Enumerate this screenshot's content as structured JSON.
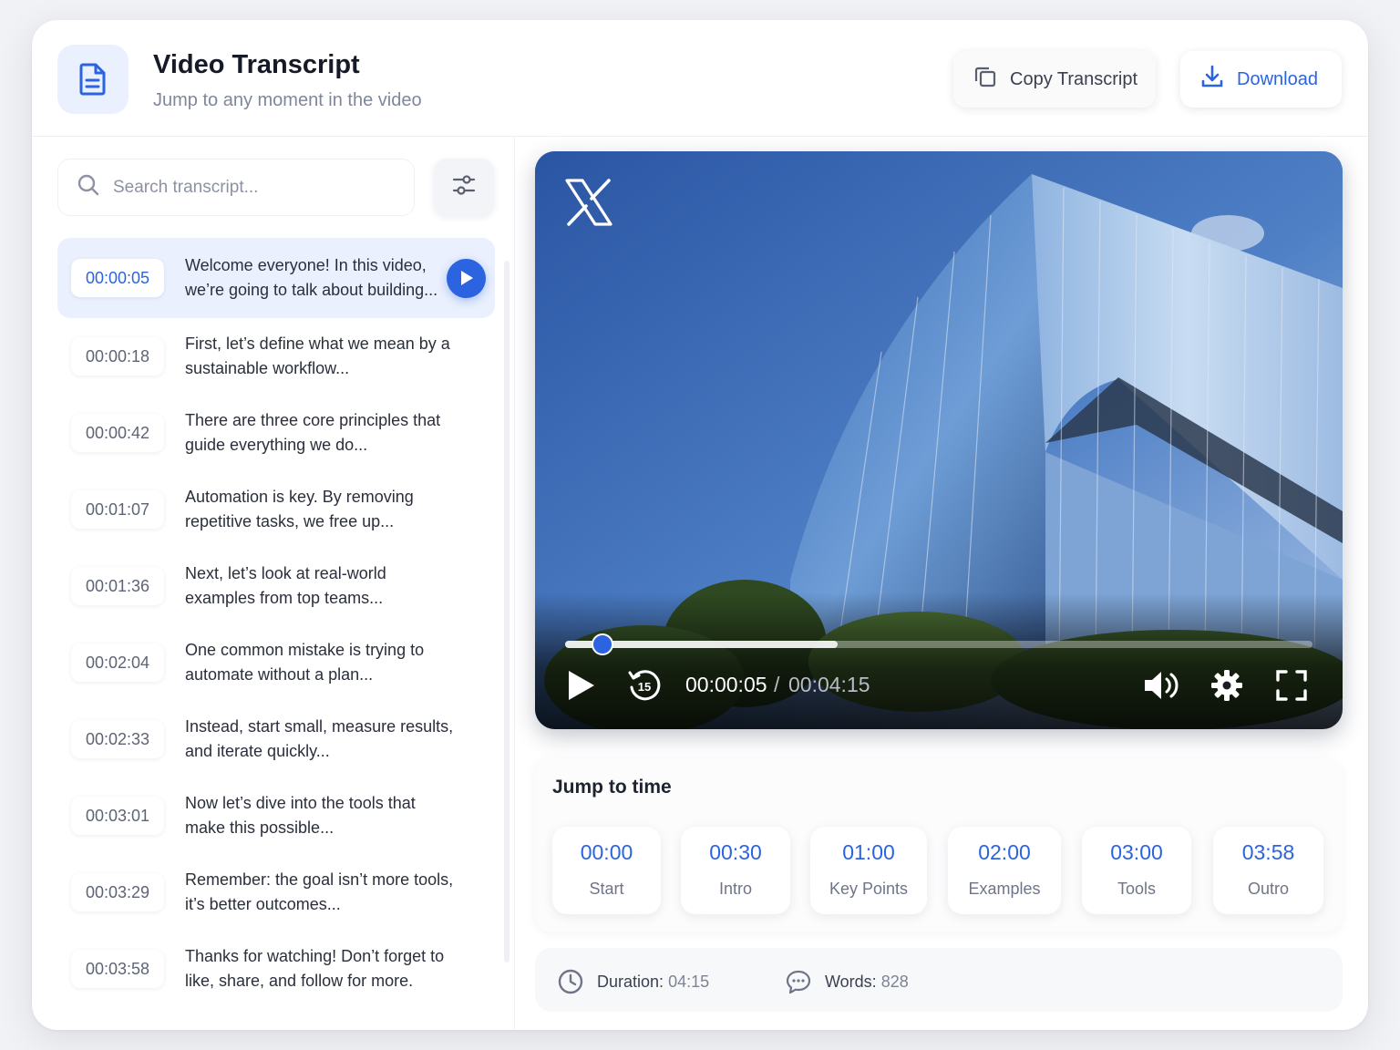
{
  "header": {
    "title": "Video Transcript",
    "subtitle": "Jump to any moment in the video",
    "copy_label": "Copy Transcript",
    "download_label": "Download"
  },
  "search": {
    "placeholder": "Search transcript..."
  },
  "transcript": [
    {
      "time": "00:00:05",
      "text": "Welcome everyone! In this video, we’re going to talk about building...",
      "active": true
    },
    {
      "time": "00:00:18",
      "text": "First, let’s define what we mean by a sustainable workflow..."
    },
    {
      "time": "00:00:42",
      "text": "There are three core principles that guide everything we do..."
    },
    {
      "time": "00:01:07",
      "text": "Automation is key. By removing repetitive tasks, we free up..."
    },
    {
      "time": "00:01:36",
      "text": "Next, let’s look at real-world examples from top teams..."
    },
    {
      "time": "00:02:04",
      "text": "One common mistake is trying to automate without a plan..."
    },
    {
      "time": "00:02:33",
      "text": "Instead, start small, measure results, and iterate quickly..."
    },
    {
      "time": "00:03:01",
      "text": "Now let’s dive into the tools that make this possible..."
    },
    {
      "time": "00:03:29",
      "text": "Remember: the goal isn’t more tools, it’s better outcomes..."
    },
    {
      "time": "00:03:58",
      "text": "Thanks for watching! Don’t forget to like, share, and follow for more."
    }
  ],
  "player": {
    "current_time": "00:00:05",
    "separator": "/",
    "total_time": "00:04:15",
    "progress_fraction": 0.05,
    "buffered_fraction": 0.365,
    "skip_back_seconds": "15",
    "logo": "X"
  },
  "jump": {
    "title": "Jump to time",
    "chips": [
      {
        "time": "00:00",
        "label": "Start"
      },
      {
        "time": "00:30",
        "label": "Intro"
      },
      {
        "time": "01:00",
        "label": "Key Points"
      },
      {
        "time": "02:00",
        "label": "Examples"
      },
      {
        "time": "03:00",
        "label": "Tools"
      },
      {
        "time": "03:58",
        "label": "Outro"
      }
    ]
  },
  "stats": {
    "duration_label": "Duration:",
    "duration_value": "04:15",
    "words_label": "Words:",
    "words_value": "828"
  },
  "colors": {
    "accent": "#2b63e0",
    "accent_soft": "#eaf0fd",
    "text": "#1f2330",
    "muted": "#80879a"
  },
  "icons": [
    "document-icon",
    "copy-icon",
    "download-icon",
    "search-icon",
    "filter-sliders-icon",
    "play-icon",
    "x-logo-icon",
    "rewind-15-icon",
    "volume-icon",
    "settings-gear-icon",
    "fullscreen-icon",
    "clock-icon",
    "chat-bubble-icon"
  ]
}
